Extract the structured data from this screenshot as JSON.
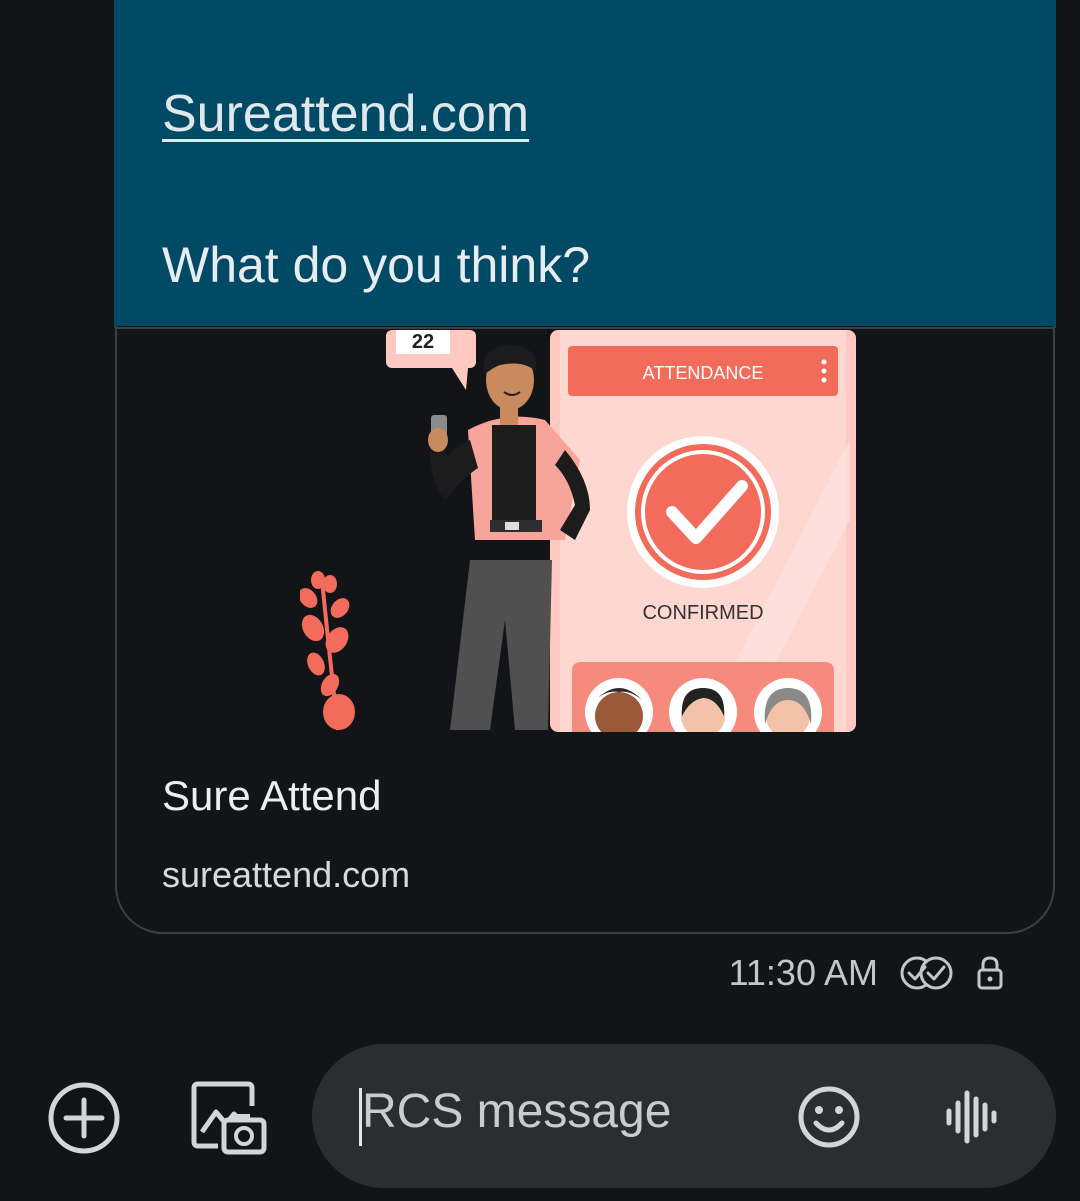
{
  "message": {
    "link_text": "Sureattend.com",
    "question": "What do you think?"
  },
  "link_preview": {
    "illustration": {
      "calendar_text": "22",
      "phone_header": "ATTENDANCE",
      "phone_status": "CONFIRMED"
    },
    "title": "Sure Attend",
    "domain": "sureattend.com"
  },
  "meta": {
    "time": "11:30 AM",
    "status_icon": "double-check-icon",
    "secure_icon": "lock-icon"
  },
  "composer": {
    "placeholder": "RCS message",
    "add_icon": "add-circle-icon",
    "gallery_icon": "gallery-camera-icon",
    "emoji_icon": "emoji-icon",
    "voice_icon": "voice-waveform-icon"
  },
  "colors": {
    "bubble": "#004a66",
    "background": "#121417",
    "accent": "#f26b5b"
  }
}
